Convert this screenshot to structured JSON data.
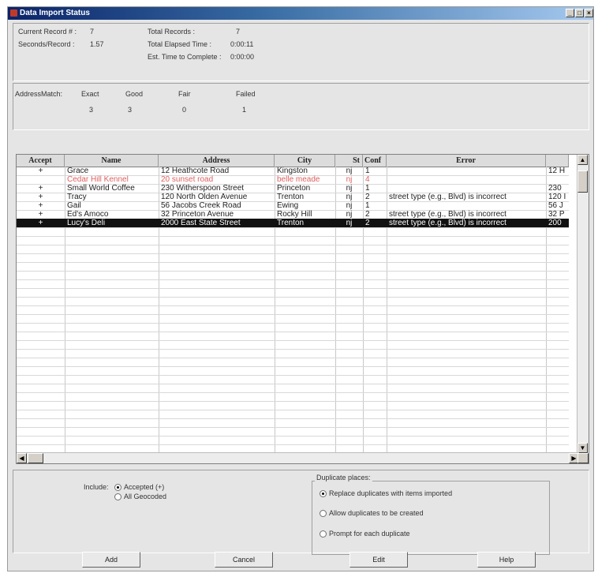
{
  "window": {
    "title": "Data Import Status"
  },
  "status": {
    "current_record_label": "Current Record # :",
    "current_record_value": "7",
    "seconds_per_record_label": "Seconds/Record :",
    "seconds_per_record_value": "1.57",
    "total_records_label": "Total Records :",
    "total_records_value": "7",
    "total_elapsed_label": "Total Elapsed Time :",
    "total_elapsed_value": "0:00:11",
    "est_time_label": "Est. Time to Complete :",
    "est_time_value": "0:00:00"
  },
  "match": {
    "label": "AddressMatch:",
    "columns": [
      {
        "name": "Exact",
        "count": "3"
      },
      {
        "name": "Good",
        "count": "3"
      },
      {
        "name": "Fair",
        "count": "0"
      },
      {
        "name": "Failed",
        "count": "1"
      }
    ]
  },
  "table": {
    "columns": [
      "Accept",
      "Name",
      "Address",
      "City",
      "St",
      "Conf",
      "Error",
      ""
    ],
    "rows": [
      {
        "accept": "+",
        "name": "Grace",
        "address": "12 Heathcote Road",
        "city": "Kingston",
        "st": "nj",
        "conf": "1",
        "error": "",
        "extra": "12 H"
      },
      {
        "accept": "",
        "name": "Cedar Hill Kennel",
        "address": "20 sunset road",
        "city": "belle meade",
        "st": "nj",
        "conf": "4",
        "error": "",
        "extra": ""
      },
      {
        "accept": "+",
        "name": "Small World Coffee",
        "address": "230 Witherspoon Street",
        "city": "Princeton",
        "st": "nj",
        "conf": "1",
        "error": "",
        "extra": "230"
      },
      {
        "accept": "+",
        "name": "Tracy",
        "address": "120 North Olden Avenue",
        "city": "Trenton",
        "st": "nj",
        "conf": "2",
        "error": "street type (e.g., Blvd) is incorrect",
        "extra": "120 I"
      },
      {
        "accept": "+",
        "name": "Gail",
        "address": "56 Jacobs Creek Road",
        "city": "Ewing",
        "st": "nj",
        "conf": "1",
        "error": "",
        "extra": "56 J"
      },
      {
        "accept": "+",
        "name": "Ed's Amoco",
        "address": "32 Princeton Avenue",
        "city": "Rocky Hill",
        "st": "nj",
        "conf": "2",
        "error": "street type (e.g., Blvd) is incorrect",
        "extra": "32 P"
      },
      {
        "accept": "+",
        "name": "Lucy's Deli",
        "address": "2000 East State Street",
        "city": "Trenton",
        "st": "nj",
        "conf": "2",
        "error": "street type (e.g., Blvd) is incorrect",
        "extra": "200"
      }
    ]
  },
  "include": {
    "label": "Include:",
    "options": [
      "Accepted (+)",
      "All Geocoded"
    ]
  },
  "duplicates": {
    "title": "Duplicate places:",
    "options": [
      "Replace duplicates with items imported",
      "Allow duplicates to be created",
      "Prompt for each duplicate"
    ]
  },
  "buttons": {
    "add": "Add",
    "cancel": "Cancel",
    "edit": "Edit",
    "help": "Help"
  },
  "colors": {
    "titlebar": "#0a246a",
    "failed_row": "#e06060",
    "selected_row": "#111111"
  }
}
